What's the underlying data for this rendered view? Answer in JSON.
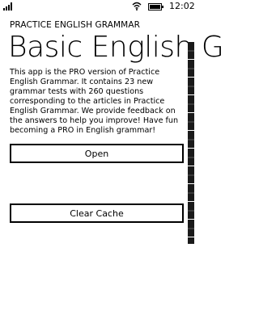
{
  "status_bar": {
    "time": "12:02",
    "icons": [
      "signal-icon",
      "wifi-icon",
      "battery-icon"
    ]
  },
  "header": {
    "app_name": "PRACTICE ENGLISH GRAMMAR",
    "page_title": "Basic English G"
  },
  "main": {
    "description": "This app is the PRO version of Practice English Grammar. It contains 23 new grammar tests with 260 questions corresponding to the articles in Practice English Grammar. We provide feedback on the answers to help you improve! Have fun becoming a PRO in English grammar!",
    "open_label": "Open",
    "clear_cache_label": "Clear Cache"
  },
  "colors": {
    "background": "#ffffff",
    "text": "#000000",
    "button_border": "#000000"
  }
}
